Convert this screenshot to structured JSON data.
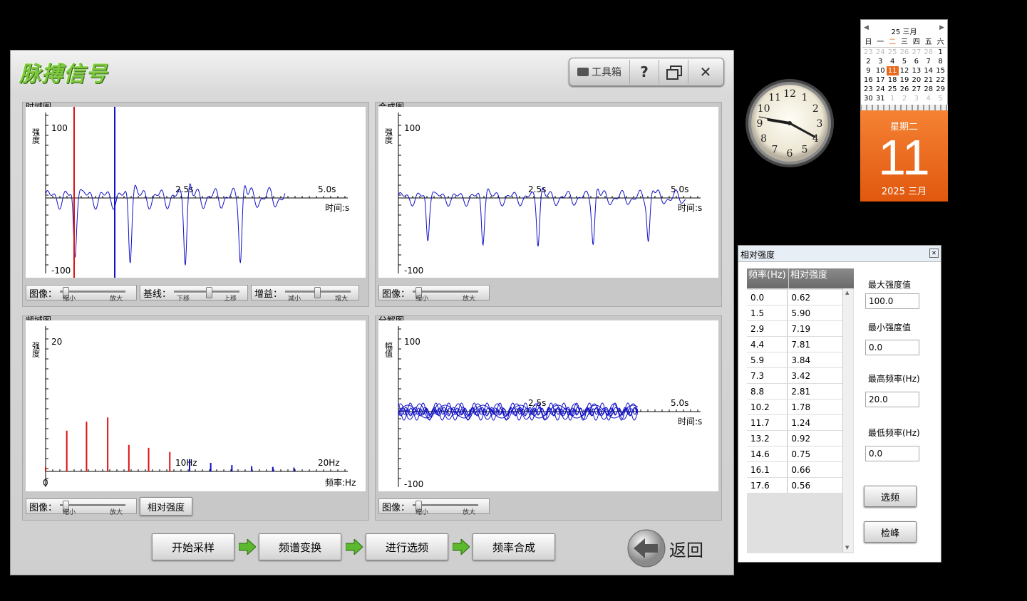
{
  "app": {
    "title": "脉搏信号"
  },
  "toolbar": {
    "toolbox": "工具箱",
    "help": "?",
    "restore_icon": "restore-icon",
    "close": "✕"
  },
  "panels": {
    "time": {
      "title": "时域图",
      "ylabel": "强度",
      "ymax": "100",
      "ymin": "-100",
      "mid": "2.5s",
      "end": "5.0s",
      "xlabel": "时间:s"
    },
    "synth": {
      "title": "合成图",
      "ylabel": "强度",
      "ymax": "100",
      "ymin": "-100",
      "mid": "2.5s",
      "end": "5.0s",
      "xlabel": "时间:s"
    },
    "freq": {
      "title": "频域图",
      "ylabel": "强度",
      "ymax": "20",
      "zero": "0",
      "mid": "10Hz",
      "end": "20Hz",
      "xlabel": "频率:Hz"
    },
    "decomp": {
      "title": "分解图",
      "ylabel": "幅值",
      "ymax": "100",
      "ymin": "-100",
      "mid": "2.5s",
      "end": "5.0s",
      "xlabel": "时间:s"
    }
  },
  "controls": {
    "image": "图像：",
    "baseline": "基线：",
    "gain": "增益：",
    "shrink": "缩小",
    "enlarge": "放大",
    "down": "下移",
    "up": "上移",
    "decrease": "减小",
    "increase": "增大",
    "relative_button": "相对强度"
  },
  "sliders": {
    "time_image": 0.05,
    "time_baseline": 0.55,
    "time_gain": 0.5,
    "synth_image": 0.05,
    "freq_image": 0.05,
    "decomp_image": 0.05
  },
  "steps": {
    "start": "开始采样",
    "fft": "频谱变换",
    "select": "进行选频",
    "compose": "频率合成",
    "back": "返回"
  },
  "dialog": {
    "title": "相对强度",
    "col_freq": "频率(Hz)",
    "col_rel": "相对强度",
    "rows": [
      [
        "0.0",
        "0.62"
      ],
      [
        "1.5",
        "5.90"
      ],
      [
        "2.9",
        "7.19"
      ],
      [
        "4.4",
        "7.81"
      ],
      [
        "5.9",
        "3.84"
      ],
      [
        "7.3",
        "3.42"
      ],
      [
        "8.8",
        "2.81"
      ],
      [
        "10.2",
        "1.78"
      ],
      [
        "11.7",
        "1.24"
      ],
      [
        "13.2",
        "0.92"
      ],
      [
        "14.6",
        "0.75"
      ],
      [
        "16.1",
        "0.66"
      ],
      [
        "17.6",
        "0.56"
      ]
    ],
    "max_label": "最大强度值",
    "max_value": "100.0",
    "min_label": "最小强度值",
    "min_value": "0.0",
    "hi_label": "最高频率(Hz)",
    "hi_value": "20.0",
    "lo_label": "最低频率(Hz)",
    "lo_value": "0.0",
    "select_btn": "选频",
    "peak_btn": "检峰"
  },
  "calendar": {
    "header": "25 三月",
    "weekdays": [
      "日",
      "一",
      "二",
      "三",
      "四",
      "五",
      "六"
    ],
    "days": [
      "23",
      "24",
      "25",
      "26",
      "27",
      "28",
      "1",
      "2",
      "3",
      "4",
      "5",
      "6",
      "7",
      "8",
      "9",
      "10",
      "11",
      "12",
      "13",
      "14",
      "15",
      "16",
      "17",
      "18",
      "19",
      "20",
      "21",
      "22",
      "23",
      "24",
      "25",
      "26",
      "27",
      "28",
      "29",
      "30",
      "31",
      "1",
      "2",
      "3",
      "4",
      "5"
    ],
    "weekday_big": "星期二",
    "day_big": "11",
    "month_big": "2025 三月"
  },
  "clock": {
    "hour": 9,
    "minute": 19,
    "second": 47,
    "numerals": [
      "12",
      "1",
      "2",
      "3",
      "4",
      "5",
      "6",
      "7",
      "8",
      "9",
      "10",
      "11"
    ]
  },
  "colors": {
    "accent_green": "#7ec840",
    "plot_blue": "#1010c8",
    "plot_red": "#e01010",
    "calendar_orange": "#e86a1e"
  },
  "chart_data": {
    "type": "bar",
    "categories": [
      "0.0",
      "1.5",
      "2.9",
      "4.4",
      "5.9",
      "7.3",
      "8.8",
      "10.2",
      "11.7",
      "13.2",
      "14.6",
      "16.1",
      "17.6"
    ],
    "values": [
      0.62,
      5.9,
      7.19,
      7.81,
      3.84,
      3.42,
      2.81,
      1.78,
      1.24,
      0.92,
      0.75,
      0.66,
      0.56
    ],
    "xlabel": "频率:Hz",
    "ylabel": "强度",
    "ylim": [
      0,
      20
    ],
    "xlim": [
      0,
      20
    ]
  }
}
